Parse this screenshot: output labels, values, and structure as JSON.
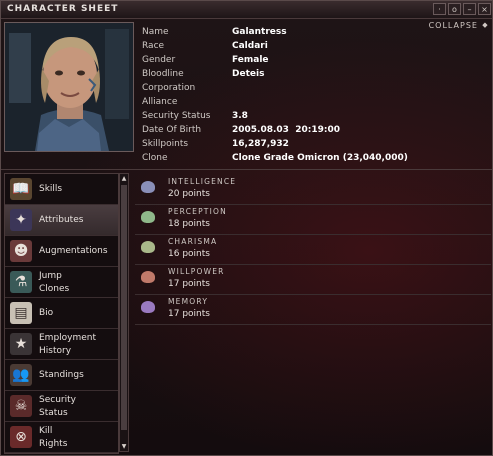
{
  "window": {
    "title": "CHARACTER SHEET",
    "collapse_label": "COLLAPSE"
  },
  "titlebar_buttons": [
    "·",
    "o",
    "–",
    "×"
  ],
  "character": {
    "fields": [
      {
        "label": "Name",
        "value": "Galantress"
      },
      {
        "label": "Race",
        "value": "Caldari"
      },
      {
        "label": "Gender",
        "value": "Female"
      },
      {
        "label": "Bloodline",
        "value": "Deteis"
      },
      {
        "label": "Corporation",
        "value": ""
      },
      {
        "label": "Alliance",
        "value": ""
      },
      {
        "label": "Security Status",
        "value": "3.8"
      },
      {
        "label": "Date Of Birth",
        "value": "2005.08.03  20:19:00"
      },
      {
        "label": "Skillpoints",
        "value": "16,287,932"
      },
      {
        "label": "Clone",
        "value": "Clone Grade Omicron (23,040,000)"
      }
    ]
  },
  "sidebar": {
    "items": [
      {
        "label": "Skills",
        "icon": "book-icon",
        "glyph": "📖"
      },
      {
        "label": "Attributes",
        "icon": "attributes-icon",
        "glyph": "✦"
      },
      {
        "label": "Augmentations",
        "icon": "implant-head-icon",
        "glyph": "☻"
      },
      {
        "label": "Jump\nClones",
        "icon": "clone-vat-icon",
        "glyph": "⚗"
      },
      {
        "label": "Bio",
        "icon": "bio-card-icon",
        "glyph": "▤"
      },
      {
        "label": "Employment\nHistory",
        "icon": "employment-stars-icon",
        "glyph": "★"
      },
      {
        "label": "Standings",
        "icon": "standings-people-icon",
        "glyph": "👥"
      },
      {
        "label": "Security\nStatus",
        "icon": "skull-crossbones-icon",
        "glyph": "☠"
      },
      {
        "label": "Kill\nRights",
        "icon": "kill-rights-icon",
        "glyph": "⊗"
      }
    ],
    "active_index": 1
  },
  "attributes": [
    {
      "name": "INTELLIGENCE",
      "value": "20 points",
      "color": "#8a8fb8"
    },
    {
      "name": "PERCEPTION",
      "value": "18 points",
      "color": "#8fb88a"
    },
    {
      "name": "CHARISMA",
      "value": "16 points",
      "color": "#a9b88a"
    },
    {
      "name": "WILLPOWER",
      "value": "17 points",
      "color": "#c07a6a"
    },
    {
      "name": "MEMORY",
      "value": "17 points",
      "color": "#9a7ac0"
    }
  ]
}
